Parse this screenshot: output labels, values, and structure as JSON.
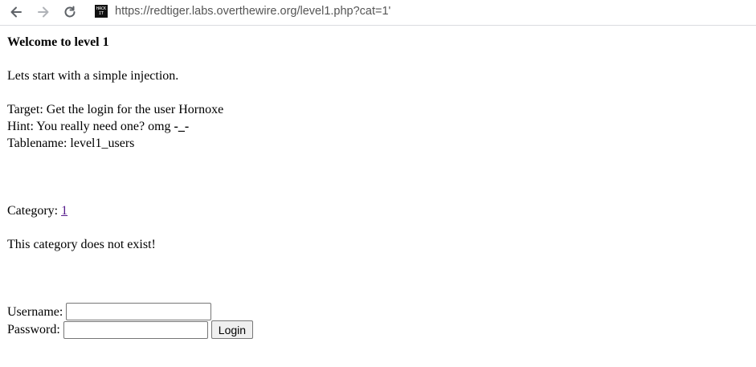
{
  "browser": {
    "favicon_text_top": "HACK",
    "favicon_text_bottom": "IT",
    "url": "https://redtiger.labs.overthewire.org/level1.php?cat=1'"
  },
  "page": {
    "title": "Welcome to level 1",
    "intro": "Lets start with a simple injection.",
    "target": "Target: Get the login for the user Hornoxe",
    "hint_prefix": "Hint: You really need one? omg ",
    "hint_emph": "-_-",
    "tablename": "Tablename: level1_users",
    "category_label": "Category: ",
    "category_link": "1",
    "error_message": "This category does not exist!",
    "username_label": "Username:",
    "password_label": "Password:",
    "username_value": "",
    "password_value": "",
    "login_button": "Login"
  }
}
